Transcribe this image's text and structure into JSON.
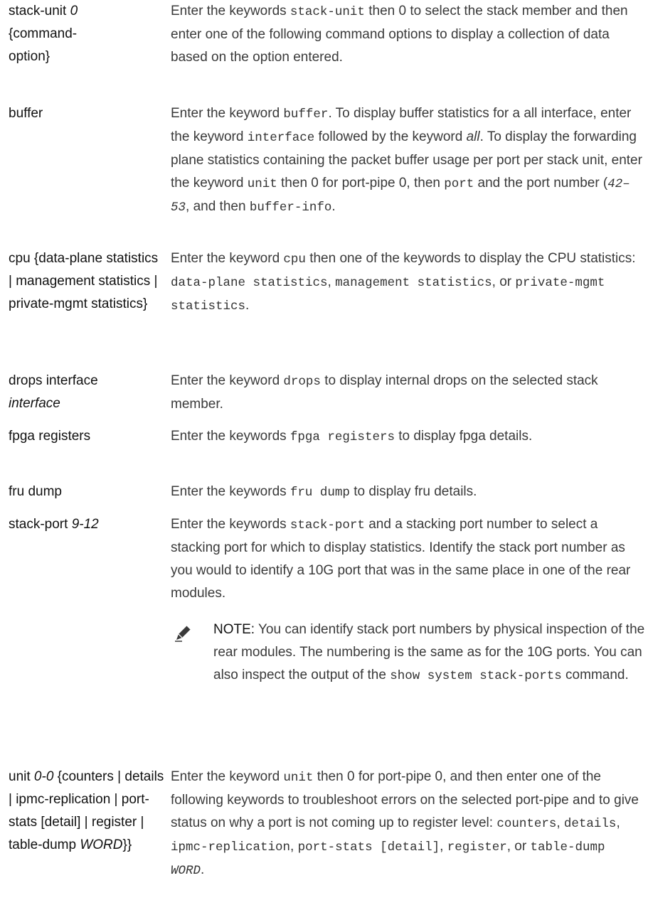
{
  "rows": [
    {
      "term": [
        "stack-unit ",
        "0",
        " {command-",
        "option}"
      ],
      "desc": [
        "Enter the keywords ",
        "stack-unit",
        " then 0 to select the stack member and then enter one of the following command options to display a collection of data based on the option entered."
      ]
    },
    {
      "term": [
        "buffer"
      ],
      "desc": [
        "Enter the keyword ",
        "buffer",
        ". To display buffer statistics for a all interface, enter the keyword ",
        "interface",
        " followed by the keyword ",
        "all",
        ". To display the forwarding plane statistics containing the packet buffer usage per port per stack unit, enter the keyword ",
        "unit",
        " then 0 for port-pipe 0, then ",
        "port",
        " and the port number (",
        "42–53",
        ", and then ",
        "buffer-info",
        "."
      ]
    },
    {
      "term": [
        "cpu {data-plane statistics | management statistics | private-mgmt statistics}"
      ],
      "desc": [
        "Enter the keyword ",
        "cpu",
        " then one of the keywords to display the CPU statistics: ",
        "data-plane statistics",
        ", ",
        "management statistics",
        ", or ",
        "private-mgmt statistics",
        "."
      ]
    },
    {
      "term": [
        "drops interface ",
        "interface"
      ],
      "desc": [
        "Enter the keyword ",
        "drops",
        " to display internal drops on the selected stack member."
      ]
    },
    {
      "term": [
        "fpga registers"
      ],
      "desc": [
        "Enter the keywords ",
        "fpga registers",
        " to display fpga details."
      ]
    },
    {
      "term": [
        "fru dump"
      ],
      "desc": [
        "Enter the keywords ",
        "fru dump",
        " to display fru details."
      ]
    },
    {
      "term": [
        "stack-port ",
        "9-12"
      ],
      "desc": [
        "Enter the keywords ",
        "stack-port",
        " and a stacking port number to select a stacking port for which to display statistics. Identify the stack port number as you would to identify a 10G port that was in the same place in one of the rear modules."
      ]
    },
    {
      "term": [
        "unit ",
        "0-0",
        " {counters | details | ipmc-replication | port-stats [detail] | register | table-dump ",
        "WORD",
        "}}"
      ],
      "desc": [
        "Enter the keyword ",
        "unit",
        " then 0 for port-pipe 0, and then enter one of the following keywords to troubleshoot errors on the selected port-pipe and to give status on why a port is not coming up to register level: ",
        "counters",
        ", ",
        "details",
        ", ",
        "ipmc-replication",
        ", ",
        "port-stats [detail]",
        ", ",
        "register",
        ", or ",
        "table-dump",
        " ",
        "WORD",
        "."
      ]
    }
  ],
  "note": {
    "label": "NOTE:",
    "text": [
      "You can identify stack port numbers by physical inspection of the rear modules. The numbering is the same as for the 10G ports. You can also inspect the output of the ",
      "show system stack-ports",
      " command."
    ],
    "icon": "pencil-icon"
  }
}
